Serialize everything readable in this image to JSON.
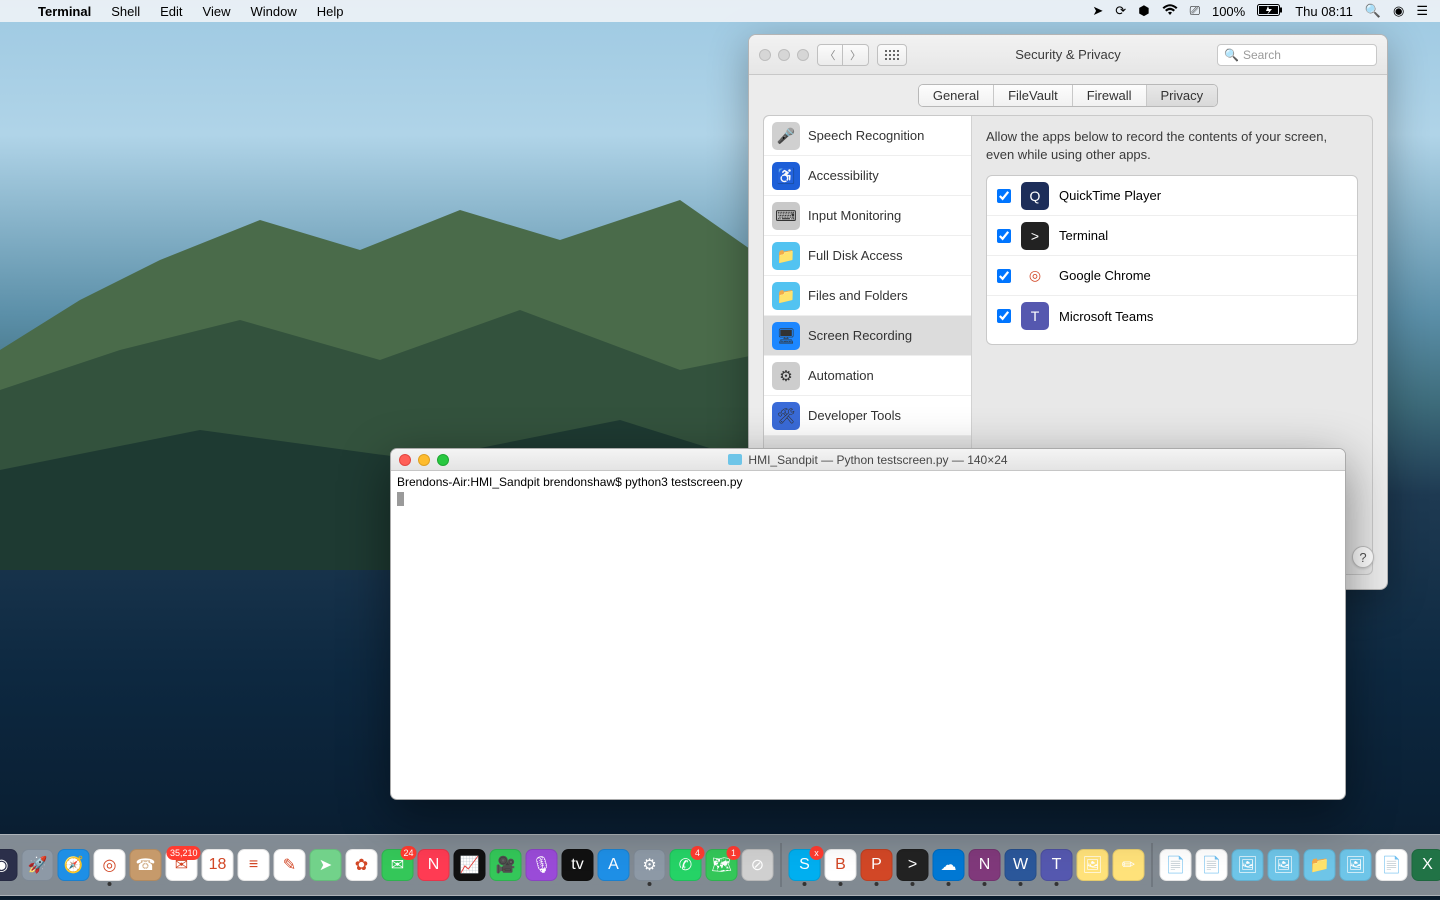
{
  "menubar": {
    "app": "Terminal",
    "items": [
      "Shell",
      "Edit",
      "View",
      "Window",
      "Help"
    ],
    "battery": "100%",
    "clock": "Thu 08:11"
  },
  "syspref": {
    "title": "Security & Privacy",
    "search_placeholder": "Search",
    "tabs": [
      "General",
      "FileVault",
      "Firewall",
      "Privacy"
    ],
    "active_tab": 3,
    "categories": [
      {
        "label": "Speech Recognition",
        "icon": "mic"
      },
      {
        "label": "Accessibility",
        "icon": "accessibility"
      },
      {
        "label": "Input Monitoring",
        "icon": "keyboard"
      },
      {
        "label": "Full Disk Access",
        "icon": "folder"
      },
      {
        "label": "Files and Folders",
        "icon": "folder"
      },
      {
        "label": "Screen Recording",
        "icon": "screen"
      },
      {
        "label": "Automation",
        "icon": "gear"
      },
      {
        "label": "Developer Tools",
        "icon": "dev"
      }
    ],
    "selected_category": 5,
    "description": "Allow the apps below to record the contents of your screen, even while using other apps.",
    "apps": [
      {
        "label": "QuickTime Player",
        "checked": true,
        "color": "#1d2e5a",
        "fg": "Q"
      },
      {
        "label": "Terminal",
        "checked": true,
        "color": "#222",
        "fg": ">"
      },
      {
        "label": "Google Chrome",
        "checked": true,
        "color": "#fff",
        "fg": "◎"
      },
      {
        "label": "Microsoft Teams",
        "checked": true,
        "color": "#5558af",
        "fg": "T"
      }
    ]
  },
  "terminal": {
    "title": "HMI_Sandpit — Python testscreen.py — 140×24",
    "line1": "Brendons-Air:HMI_Sandpit brendonshaw$ python3 testscreen.py"
  },
  "dock": {
    "apps": [
      {
        "name": "finder",
        "color": "#1d9bf0",
        "glyph": "☺",
        "running": true
      },
      {
        "name": "siri",
        "color": "#2b2f4a",
        "glyph": "◉"
      },
      {
        "name": "launchpad",
        "color": "#8d99a6",
        "glyph": "🚀"
      },
      {
        "name": "safari",
        "color": "#1e8fe6",
        "glyph": "🧭"
      },
      {
        "name": "chrome",
        "color": "#fff",
        "glyph": "◎",
        "running": true
      },
      {
        "name": "contacts",
        "color": "#c69a6b",
        "glyph": "☎"
      },
      {
        "name": "mail",
        "color": "#fff",
        "glyph": "✉",
        "badge": "35,210"
      },
      {
        "name": "calendar",
        "color": "#fff",
        "glyph": "18"
      },
      {
        "name": "reminders",
        "color": "#fff",
        "glyph": "≡"
      },
      {
        "name": "notes",
        "color": "#fff",
        "glyph": "✎"
      },
      {
        "name": "maps",
        "color": "#72d28a",
        "glyph": "➤"
      },
      {
        "name": "photos",
        "color": "#fff",
        "glyph": "✿"
      },
      {
        "name": "messages",
        "color": "#34c759",
        "glyph": "✉",
        "badge": "24"
      },
      {
        "name": "news",
        "color": "#ff3b53",
        "glyph": "N"
      },
      {
        "name": "stocks",
        "color": "#111",
        "glyph": "📈"
      },
      {
        "name": "facetime",
        "color": "#34c759",
        "glyph": "🎥"
      },
      {
        "name": "podcasts",
        "color": "#9a4bd8",
        "glyph": "🎙"
      },
      {
        "name": "tv",
        "color": "#111",
        "glyph": "tv"
      },
      {
        "name": "appstore",
        "color": "#1e8fe6",
        "glyph": "A"
      },
      {
        "name": "syspref",
        "color": "#8d99a6",
        "glyph": "⚙",
        "running": true
      },
      {
        "name": "whatsapp",
        "color": "#25d366",
        "glyph": "✆",
        "badge": "4"
      },
      {
        "name": "maps2",
        "color": "#34c759",
        "glyph": "🗺",
        "badge": "1"
      },
      {
        "name": "blocked",
        "color": "#d0d0d0",
        "glyph": "⊘"
      }
    ],
    "right": [
      {
        "name": "skype",
        "color": "#00aff0",
        "glyph": "S",
        "running": true,
        "badge": "x"
      },
      {
        "name": "bbedit",
        "color": "#fff",
        "glyph": "B",
        "running": true
      },
      {
        "name": "powerpoint",
        "color": "#d24726",
        "glyph": "P",
        "running": true
      },
      {
        "name": "terminal",
        "color": "#222",
        "glyph": ">",
        "running": true
      },
      {
        "name": "onedrive",
        "color": "#0078d4",
        "glyph": "☁",
        "running": true
      },
      {
        "name": "onenote",
        "color": "#80397b",
        "glyph": "N",
        "running": true
      },
      {
        "name": "word",
        "color": "#2b579a",
        "glyph": "W",
        "running": true
      },
      {
        "name": "teams",
        "color": "#5558af",
        "glyph": "T",
        "running": true
      },
      {
        "name": "preview",
        "color": "#ffe27a",
        "glyph": "🖼"
      },
      {
        "name": "stickies",
        "color": "#ffe27a",
        "glyph": "✏"
      }
    ],
    "files": [
      {
        "name": "doc1",
        "color": "#fff",
        "glyph": "📄"
      },
      {
        "name": "doc2",
        "color": "#fff",
        "glyph": "📄"
      },
      {
        "name": "img1",
        "color": "#6ec5e8",
        "glyph": "🖼"
      },
      {
        "name": "img2",
        "color": "#6ec5e8",
        "glyph": "🖼"
      },
      {
        "name": "folder",
        "color": "#6ec5e8",
        "glyph": "📁"
      },
      {
        "name": "img3",
        "color": "#6ec5e8",
        "glyph": "🖼"
      },
      {
        "name": "doc3",
        "color": "#fff",
        "glyph": "📄"
      },
      {
        "name": "excel",
        "color": "#217346",
        "glyph": "X"
      }
    ],
    "trash": {
      "name": "trash",
      "glyph": "🗑"
    }
  }
}
